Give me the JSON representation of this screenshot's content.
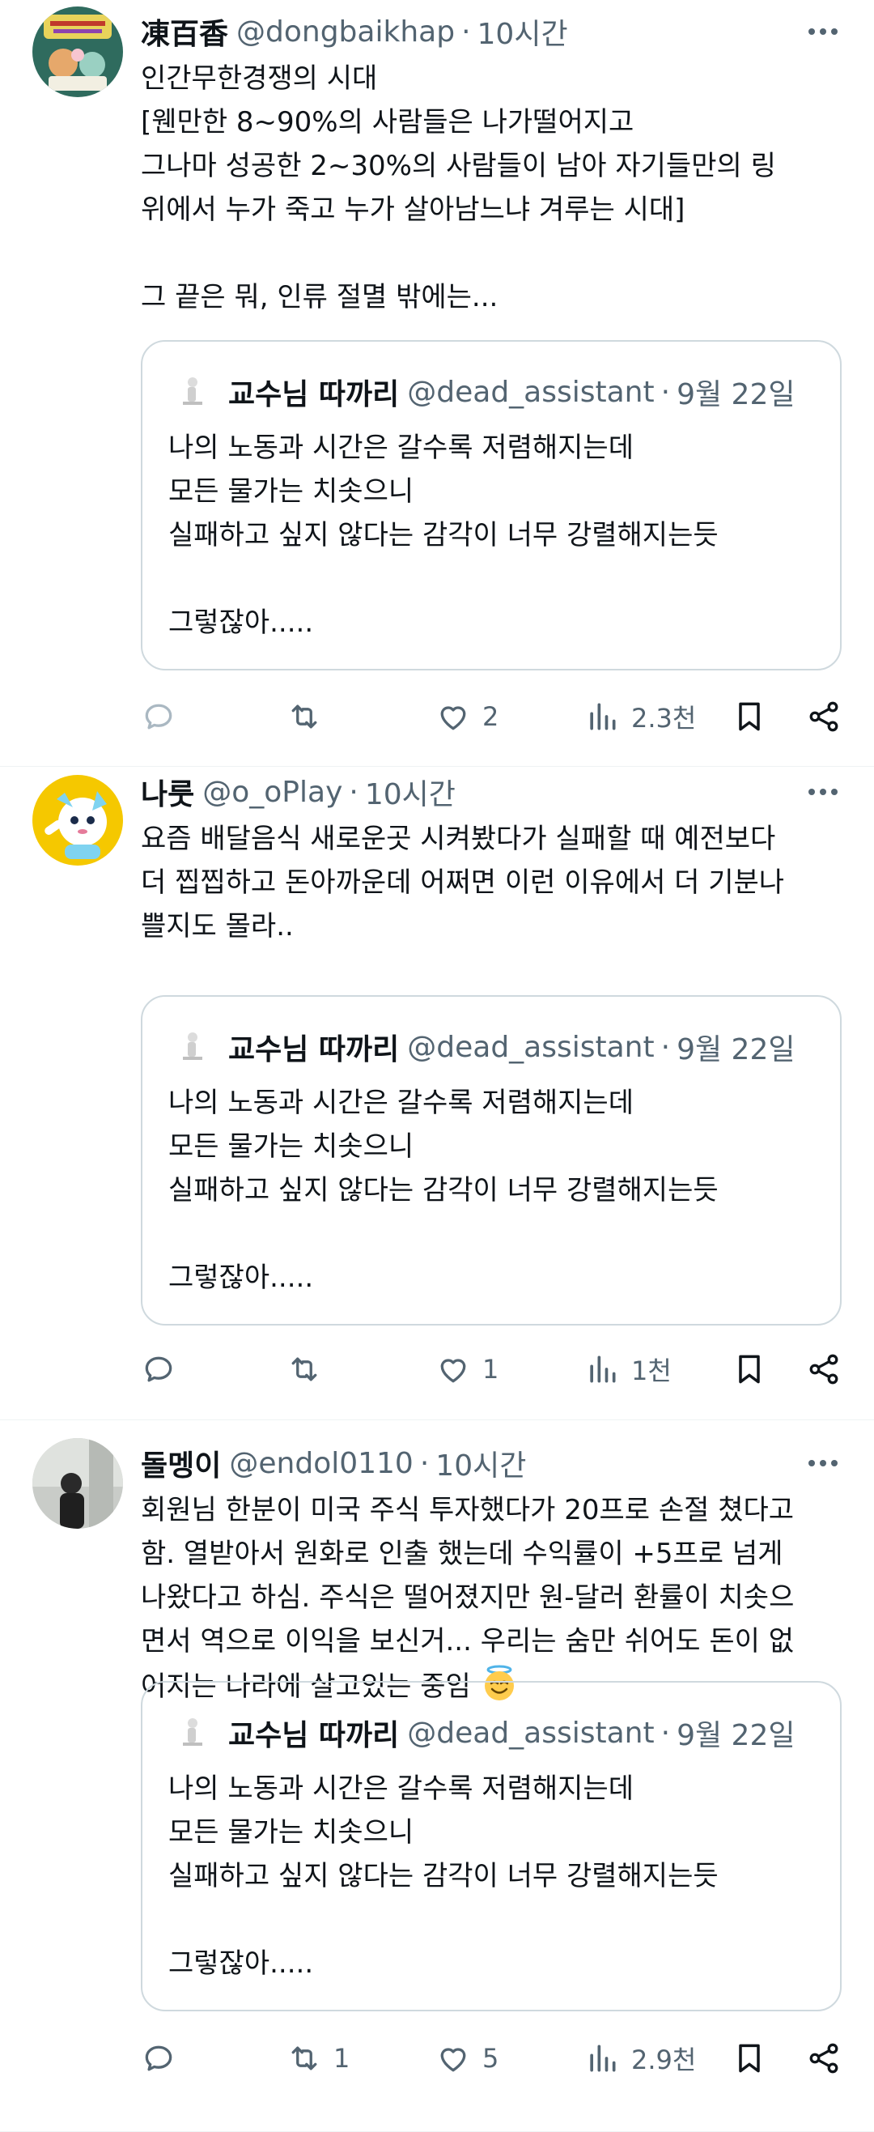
{
  "tweets": [
    {
      "name": "凍百香",
      "handle": "@dongbaikhap",
      "time": "10시간",
      "text": "인간무한경쟁의 시대\n[웬만한 8~90%의 사람들은 나가떨어지고\n그나마 성공한 2~30%의 사람들이 남아 자기들만의 링\n위에서 누가 죽고 누가 살아남느냐 겨루는 시대]\n\n그 끝은 뭐, 인류 절멸 밖에는...",
      "quote": {
        "name": "교수님 따까리",
        "handle": "@dead_assistant",
        "date": "9월 22일",
        "text": "나의 노동과 시간은 갈수록 저렴해지는데\n모든 물가는 치솟으니\n실패하고 싶지 않다는 감각이 너무 강렬해지는듯\n\n그렇잖아....."
      },
      "replies": "",
      "retweets": "",
      "likes": "2",
      "views": "2.3천"
    },
    {
      "name": "나룻",
      "handle": "@o_oPlay",
      "time": "10시간",
      "text": "요즘 배달음식 새로운곳 시켜봤다가 실패할 때 예전보다\n더 찝찝하고 돈아까운데 어쩌면 이런 이유에서 더 기분나\n쁠지도 몰라..",
      "quote": {
        "name": "교수님 따까리",
        "handle": "@dead_assistant",
        "date": "9월 22일",
        "text": "나의 노동과 시간은 갈수록 저렴해지는데\n모든 물가는 치솟으니\n실패하고 싶지 않다는 감각이 너무 강렬해지는듯\n\n그렇잖아....."
      },
      "replies": "",
      "retweets": "",
      "likes": "1",
      "views": "1천"
    },
    {
      "name": "돌멩이",
      "handle": "@endol0110",
      "time": "10시간",
      "text": "회원님 한분이 미국 주식 투자했다가 20프로 손절 쳤다고\n함. 열받아서 원화로 인출 했는데 수익률이 +5프로 넘게\n나왔다고 하심. 주식은 떨어졌지만 원-달러 환률이 치솟으\n면서 역으로 이익을 보신거... 우리는 숨만 쉬어도 돈이 없\n어지는 나라에 살고있는 중임",
      "emoji": "😇",
      "quote": {
        "name": "교수님 따까리",
        "handle": "@dead_assistant",
        "date": "9월 22일",
        "text": "나의 노동과 시간은 갈수록 저렴해지는데\n모든 물가는 치솟으니\n실패하고 싶지 않다는 감각이 너무 강렬해지는듯\n\n그렇잖아....."
      },
      "replies": "",
      "retweets": "1",
      "likes": "5",
      "views": "2.9천"
    }
  ],
  "icons": {
    "reply": "reply-icon",
    "retweet": "retweet-icon",
    "like": "heart-icon",
    "views": "views-icon",
    "bookmark": "bookmark-icon",
    "share": "share-icon",
    "more": "more-icon"
  },
  "colors": {
    "text": "#0f1419",
    "secondary": "#536471",
    "border": "#cfd9de",
    "divider": "#eff3f4"
  }
}
